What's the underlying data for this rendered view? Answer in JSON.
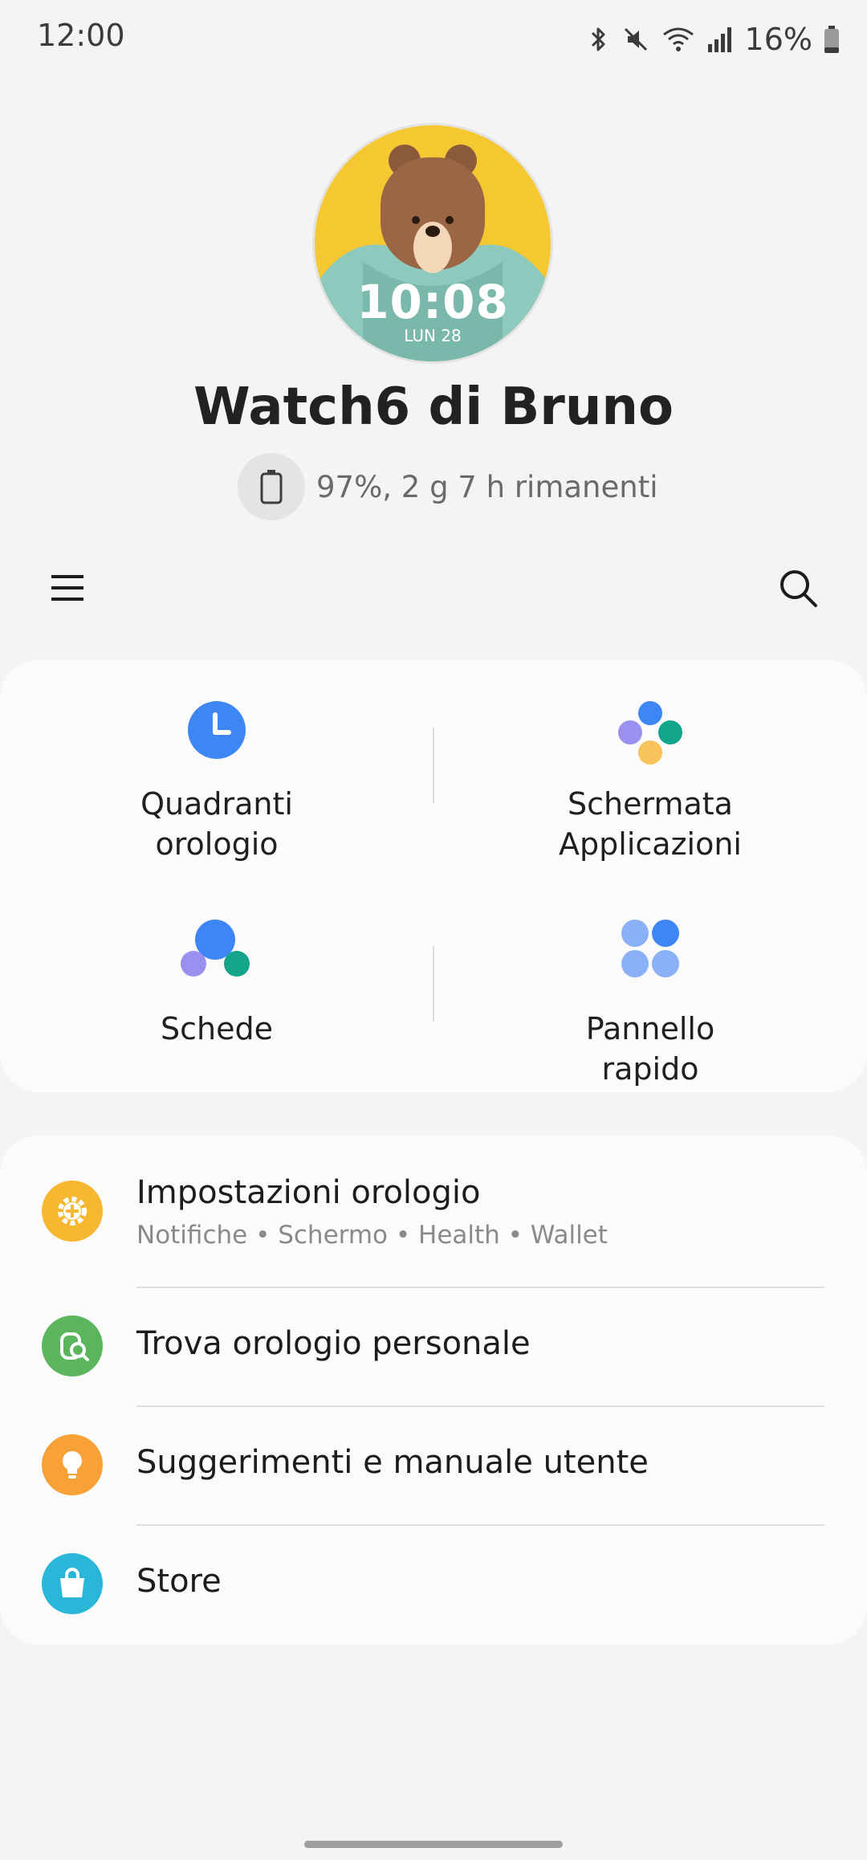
{
  "status_bar": {
    "time": "12:00",
    "battery_percent": "16%"
  },
  "watch": {
    "face_time": "10:08",
    "face_date": "LUN 28",
    "name": "Watch6 di Bruno",
    "battery_status": "97%, 2 g 7 h rimanenti"
  },
  "shortcuts": [
    {
      "label": "Quadranti\norologio",
      "icon": "clock-icon"
    },
    {
      "label": "Schermata\nApplicazioni",
      "icon": "apps-dots-icon"
    },
    {
      "label": "Schede",
      "icon": "tiles-icon"
    },
    {
      "label": "Pannello\nrapido",
      "icon": "quick-panel-icon"
    }
  ],
  "menu_list": [
    {
      "title": "Impostazioni orologio",
      "subtitle": "Notifiche • Schermo • Health • Wallet",
      "icon": "settings-gear-icon",
      "color": "#f7b731"
    },
    {
      "title": "Trova orologio personale",
      "icon": "find-watch-icon",
      "color": "#5bb55d"
    },
    {
      "title": "Suggerimenti e manuale utente",
      "icon": "lightbulb-icon",
      "color": "#f7a136"
    },
    {
      "title": "Store",
      "icon": "shopping-bag-icon",
      "color": "#29b6d8"
    }
  ],
  "colors": {
    "background": "#f4f4f4",
    "card": "#fbfbfb",
    "accent_blue": "#3f86f5"
  }
}
